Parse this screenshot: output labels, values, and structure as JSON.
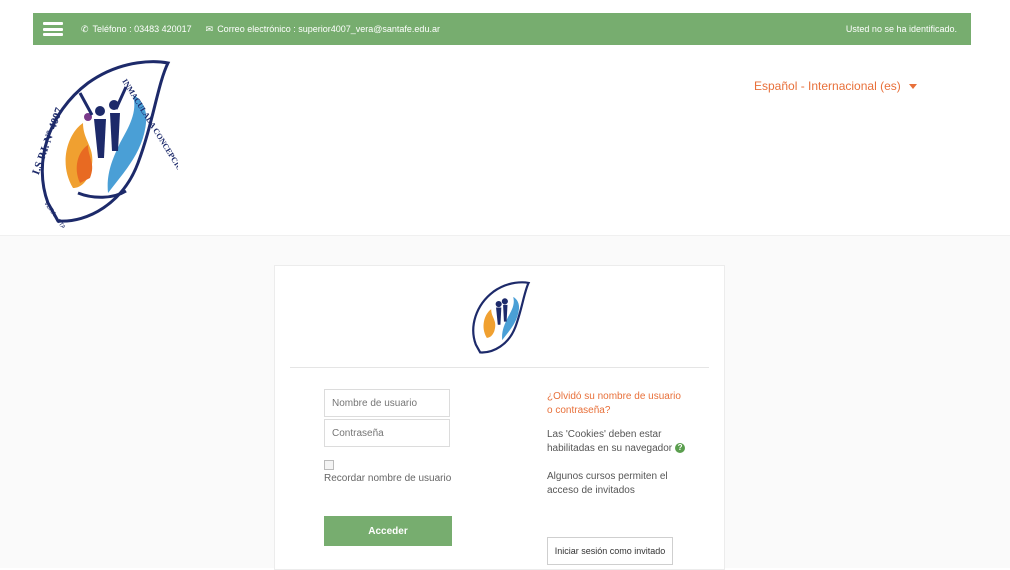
{
  "topbar": {
    "phone_icon": "phone-icon",
    "phone": "Teléfono : 03483 420017",
    "email_icon": "envelope-icon",
    "email": "Correo electrónico : superior4007_vera@santafe.edu.ar",
    "login_status": "Usted no se ha identificado."
  },
  "header": {
    "logo": {
      "lettering_left": "I.S.P.I. Nº 4007",
      "lettering_right": "INMACULADA CONCEPCIÓN",
      "lettering_bottom": "VERA - STA. FE"
    },
    "language": "Español - Internacional (es)"
  },
  "login": {
    "username_placeholder": "Nombre de usuario",
    "password_placeholder": "Contraseña",
    "remember_label": "Recordar nombre de usuario",
    "submit_label": "Acceder",
    "forgot_link": "¿Olvidó su nombre de usuario o contraseña?",
    "cookies_text": "Las 'Cookies' deben estar habilitadas en su navegador",
    "help_icon": "question-icon",
    "guest_text": "Algunos cursos permiten el acceso de invitados",
    "guest_button": "Iniciar sesión como invitado"
  },
  "colors": {
    "accent_green": "#77ad6f",
    "link_orange": "#e8703a"
  }
}
